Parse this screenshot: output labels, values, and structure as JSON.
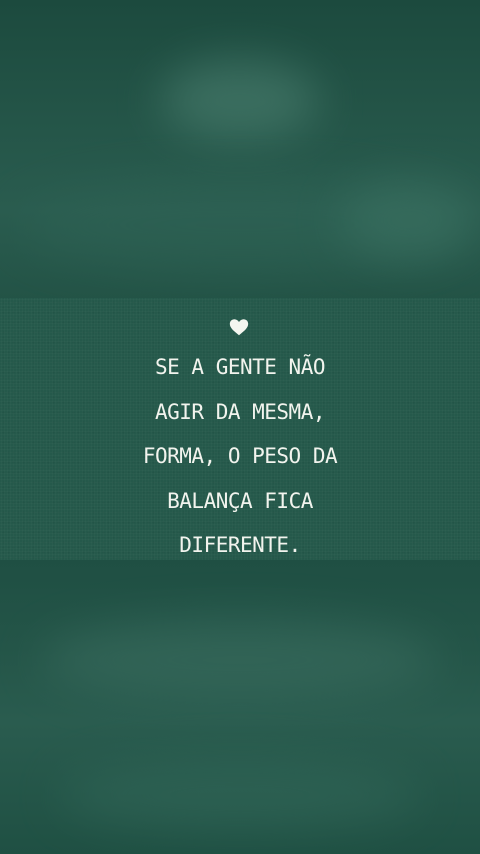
{
  "quote": {
    "lines": [
      "SE A GENTE NÃO",
      "AGIR DA MESMA,",
      "FORMA, O PESO DA",
      "BALANÇA FICA",
      "DIFERENTE."
    ],
    "icon": "heart-icon"
  },
  "colors": {
    "background": "#1f4d40",
    "card": "#25594b",
    "text": "#f2f4ee"
  }
}
